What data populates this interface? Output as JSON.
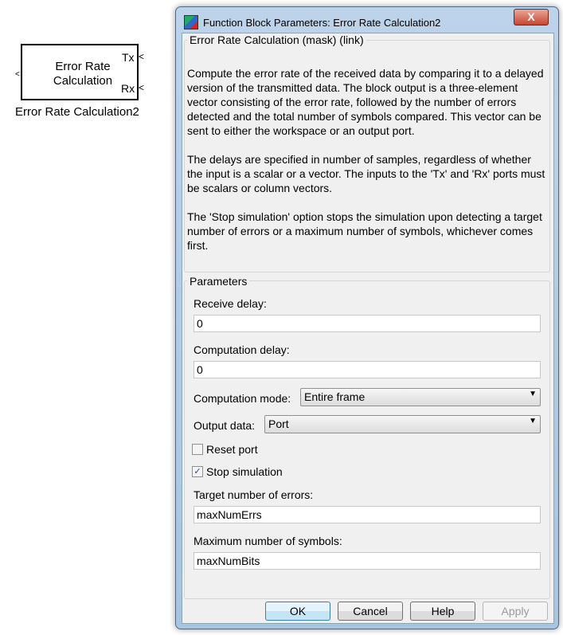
{
  "block": {
    "name": "Error Rate Calculation2",
    "label_line1": "Error Rate",
    "label_line2": "Calculation",
    "port_tx": "Tx",
    "port_rx": "Rx"
  },
  "dialog": {
    "title": "Function Block Parameters: Error Rate Calculation2",
    "close_label": "X",
    "description_group": "Error Rate Calculation (mask) (link)",
    "description_p1": "Compute the error rate of the received data by comparing it to a delayed version of the transmitted data. The block output is a three-element vector consisting of the error rate, followed by the number of errors detected and the total number of symbols compared. This vector can be sent to either the workspace or an output port.",
    "description_p2": "The delays are specified in number of samples, regardless of whether the input is a scalar or a vector. The inputs to the 'Tx' and 'Rx' ports must be scalars or column vectors.",
    "description_p3": "The 'Stop simulation' option stops the simulation upon detecting a target number of errors or a maximum number of symbols, whichever comes first.",
    "parameters_group": "Parameters",
    "receive_delay_label": "Receive delay:",
    "receive_delay": "0",
    "computation_delay_label": "Computation delay:",
    "computation_delay": "0",
    "computation_mode_label": "Computation mode:",
    "computation_mode": "Entire frame",
    "output_data_label": "Output data:",
    "output_data": "Port",
    "reset_port_label": "Reset port",
    "reset_port": false,
    "stop_simulation_label": "Stop simulation",
    "stop_simulation": true,
    "target_errors_label": "Target number of errors:",
    "target_errors": "maxNumErrs",
    "max_symbols_label": "Maximum number of symbols:",
    "max_symbols": "maxNumBits",
    "buttons": {
      "ok": "OK",
      "cancel": "Cancel",
      "help": "Help",
      "apply": "Apply"
    }
  }
}
